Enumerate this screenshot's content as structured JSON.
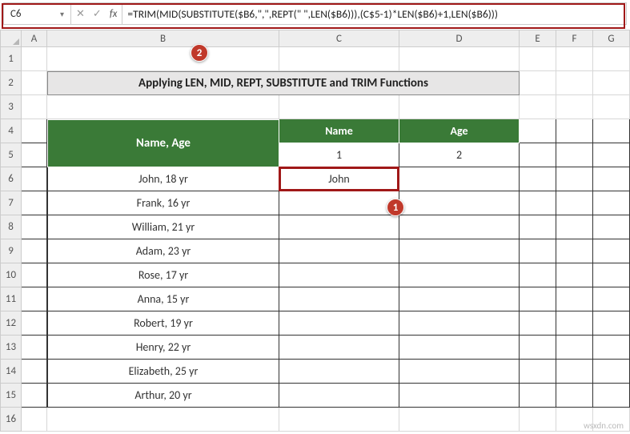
{
  "namebox": "C6",
  "formula": "=TRIM(MID(SUBSTITUTE($B6,\",\",REPT(\" \",LEN($B6))),(C$5-1)*LEN($B6)+1,LEN($B6)))",
  "columns": [
    "A",
    "B",
    "C",
    "D",
    "E",
    "F",
    "G"
  ],
  "rows": [
    "1",
    "2",
    "3",
    "4",
    "5",
    "6",
    "7",
    "8",
    "9",
    "10",
    "11",
    "12",
    "13",
    "14",
    "15",
    "16"
  ],
  "title": "Applying LEN, MID, REPT, SUBSTITUTE and TRIM Functions",
  "headers": {
    "nameAge": "Name, Age",
    "name": "Name",
    "age": "Age",
    "nameIndex": "1",
    "ageIndex": "2"
  },
  "dataRows": [
    {
      "b": "John, 18 yr",
      "c": "John",
      "d": ""
    },
    {
      "b": "Frank, 16 yr",
      "c": "",
      "d": ""
    },
    {
      "b": "William, 21 yr",
      "c": "",
      "d": ""
    },
    {
      "b": "Adam, 23 yr",
      "c": "",
      "d": ""
    },
    {
      "b": "Rose, 17 yr",
      "c": "",
      "d": ""
    },
    {
      "b": "Anna, 15 yr",
      "c": "",
      "d": ""
    },
    {
      "b": "Robert, 19 yr",
      "c": "",
      "d": ""
    },
    {
      "b": "Henry, 22 yr",
      "c": "",
      "d": ""
    },
    {
      "b": "Elizabeth, 25 yr",
      "c": "",
      "d": ""
    },
    {
      "b": "Arthur, 20 yr",
      "c": "",
      "d": ""
    }
  ],
  "callouts": {
    "one": "1",
    "two": "2"
  },
  "watermark": "wsxdn.com"
}
